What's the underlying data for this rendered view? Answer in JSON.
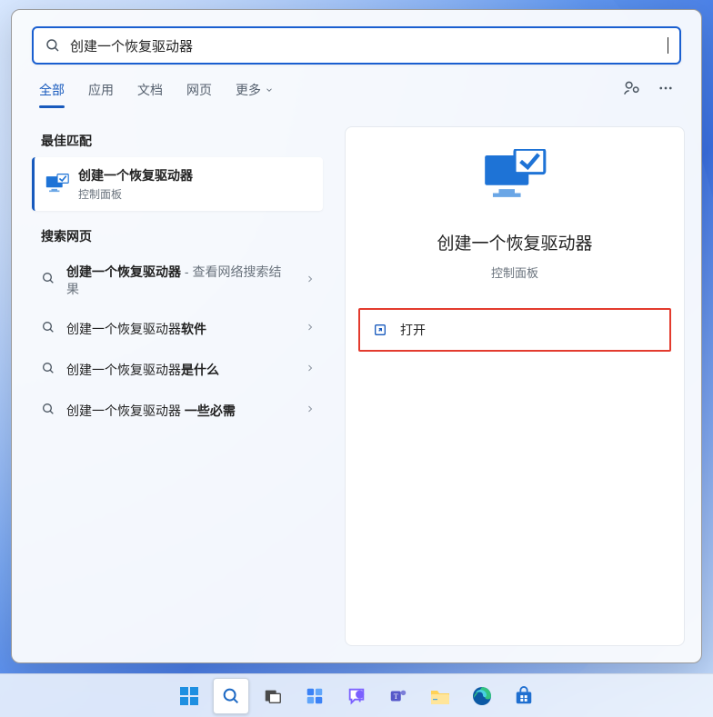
{
  "search": {
    "query": "创建一个恢复驱动器"
  },
  "tabs": {
    "all": "全部",
    "apps": "应用",
    "documents": "文档",
    "web": "网页",
    "more": "更多"
  },
  "sections": {
    "best_match": "最佳匹配",
    "search_web": "搜索网页"
  },
  "best_match": {
    "title": "创建一个恢复驱动器",
    "subtitle": "控制面板"
  },
  "web_results": [
    {
      "bold": "创建一个恢复驱动器",
      "suffix": " - 查看网络搜索结果"
    },
    {
      "bold": "创建一个恢复驱动器",
      "suffix": "软件",
      "suffix_bold": true
    },
    {
      "bold": "创建一个恢复驱动器",
      "suffix": "是什么",
      "suffix_bold": true
    },
    {
      "bold": "创建一个恢复驱动器 一些必需",
      "suffix": "",
      "prefix_plain": "创建一个恢复驱动器 ",
      "tail_bold": "一些必需"
    }
  ],
  "preview": {
    "title": "创建一个恢复驱动器",
    "subtitle": "控制面板",
    "open_label": "打开"
  },
  "taskbar": {
    "items": [
      "start",
      "search",
      "taskview",
      "widgets",
      "chat",
      "teams",
      "explorer",
      "edge",
      "store"
    ]
  }
}
